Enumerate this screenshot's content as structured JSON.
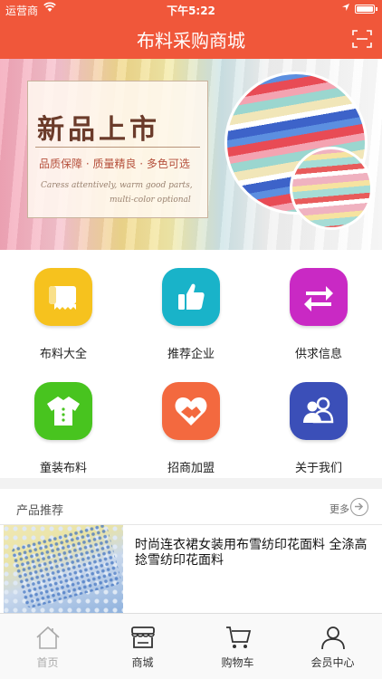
{
  "status_bar": {
    "carrier": "运营商",
    "time": "下午5:22"
  },
  "header": {
    "title": "布料采购商城",
    "scan_icon": "scan-icon"
  },
  "banner": {
    "headline": "新品上市",
    "slogan": "品质保障 · 质量精良 · 多色可选",
    "english_line1": "Caress attentively, warm good parts,",
    "english_line2": "multi-color optional"
  },
  "categories": [
    {
      "label": "布料大全",
      "icon": "fabric-roll-icon",
      "color": "#f6c21e"
    },
    {
      "label": "推荐企业",
      "icon": "thumbs-up-icon",
      "color": "#19b3c9"
    },
    {
      "label": "供求信息",
      "icon": "exchange-arrows-icon",
      "color": "#c929c4"
    },
    {
      "label": "童装布料",
      "icon": "shirt-icon",
      "color": "#48c41f"
    },
    {
      "label": "招商加盟",
      "icon": "heart-handshake-icon",
      "color": "#f3693f"
    },
    {
      "label": "关于我们",
      "icon": "people-icon",
      "color": "#3b4fb8"
    }
  ],
  "products": {
    "section_title": "产品推荐",
    "more_label": "更多",
    "items": [
      {
        "name": "时尚连衣裙女装用布雪纺印花面料 全涤高捻雪纺印花面料"
      }
    ]
  },
  "tab_bar": [
    {
      "label": "首页",
      "icon": "home-icon"
    },
    {
      "label": "商城",
      "icon": "store-icon"
    },
    {
      "label": "购物车",
      "icon": "cart-icon"
    },
    {
      "label": "会员中心",
      "icon": "user-icon"
    }
  ]
}
